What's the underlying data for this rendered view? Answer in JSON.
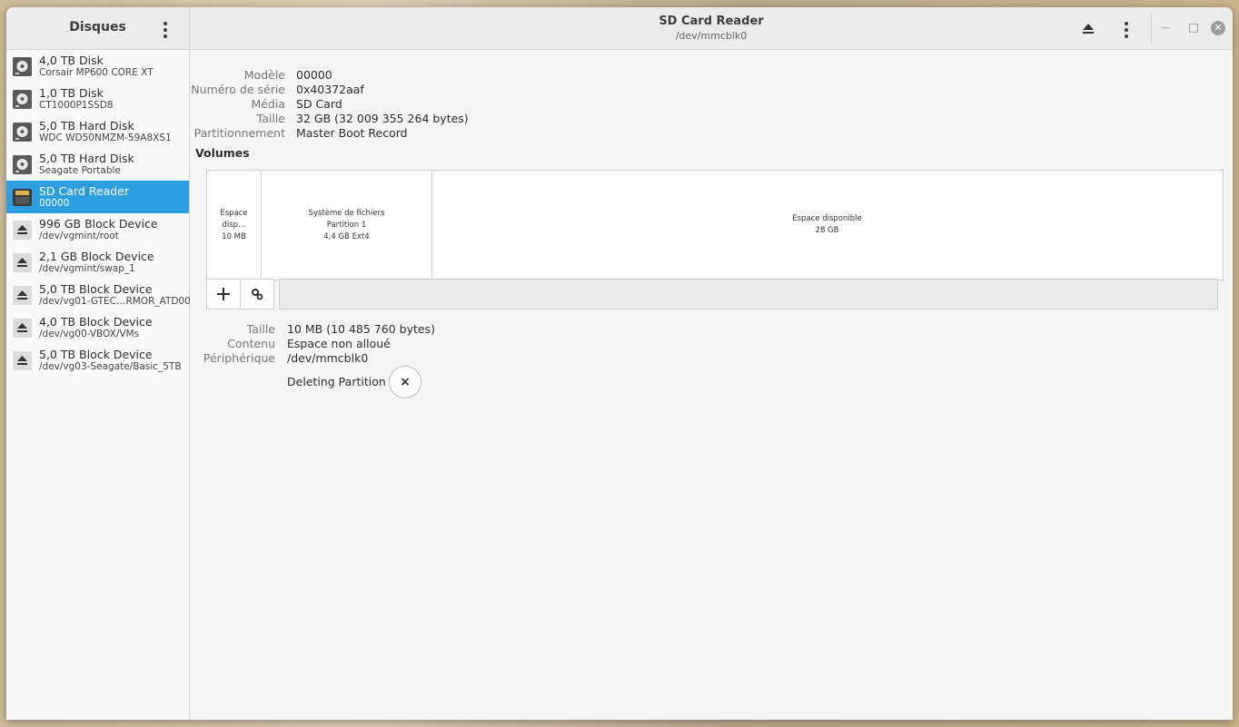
{
  "sidebar": {
    "title": "Disques",
    "items": [
      {
        "name": "4,0 TB Disk",
        "sub": "Corsair MP600 CORE XT",
        "icon": "hard-disk-icon"
      },
      {
        "name": "1,0 TB Disk",
        "sub": "CT1000P1SSD8",
        "icon": "hard-disk-icon"
      },
      {
        "name": "5,0 TB Hard Disk",
        "sub": "WDC WD50NMZM-59A8XS1",
        "icon": "hard-disk-icon"
      },
      {
        "name": "5,0 TB Hard Disk",
        "sub": "Seagate Portable",
        "icon": "hard-disk-icon"
      },
      {
        "name": "SD Card Reader",
        "sub": "00000",
        "icon": "sd-card-icon",
        "selected": true
      },
      {
        "name": "996 GB Block Device",
        "sub": "/dev/vgmint/root",
        "icon": "eject-icon"
      },
      {
        "name": "2,1 GB Block Device",
        "sub": "/dev/vgmint/swap_1",
        "icon": "eject-icon"
      },
      {
        "name": "5,0 TB Block Device",
        "sub": "/dev/vg01-GTEC…RMOR_ATD00",
        "icon": "eject-icon"
      },
      {
        "name": "4,0 TB Block Device",
        "sub": "/dev/vg00-VBOX/VMs",
        "icon": "eject-icon"
      },
      {
        "name": "5,0 TB Block Device",
        "sub": "/dev/vg03-Seagate/Basic_5TB",
        "icon": "eject-icon"
      }
    ]
  },
  "header": {
    "title": "SD Card Reader",
    "subtitle": "/dev/mmcblk0"
  },
  "device_info": [
    {
      "key": "Modèle",
      "value": "00000"
    },
    {
      "key": "Numéro de série",
      "value": "0x40372aaf"
    },
    {
      "key": "Média",
      "value": "SD Card"
    },
    {
      "key": "Taille",
      "value": "32 GB (32 009 355 264 bytes)"
    },
    {
      "key": "Partitionnement",
      "value": "Master Boot Record"
    }
  ],
  "volumes": {
    "title": "Volumes",
    "segments": [
      {
        "lines": [
          "Espace disp…",
          "10 MB"
        ],
        "share": 0.054
      },
      {
        "lines": [
          "Système de fichiers",
          "Partition 1",
          "4,4 GB Ext4"
        ],
        "share": 0.168
      },
      {
        "lines": [
          "Espace disponible",
          "28 GB"
        ],
        "share": 0.778
      }
    ],
    "add_label": "+",
    "settings_label": "⚙"
  },
  "selection_info": [
    {
      "key": "Taille",
      "value": "10 MB (10 485 760 bytes)"
    },
    {
      "key": "Contenu",
      "value": "Espace non alloué"
    },
    {
      "key": "Périphérique",
      "value": "/dev/mmcblk0"
    }
  ],
  "job": {
    "label": "Deleting Partition",
    "cancel": "×"
  },
  "colors": {
    "accent": "#2d9ee0"
  }
}
